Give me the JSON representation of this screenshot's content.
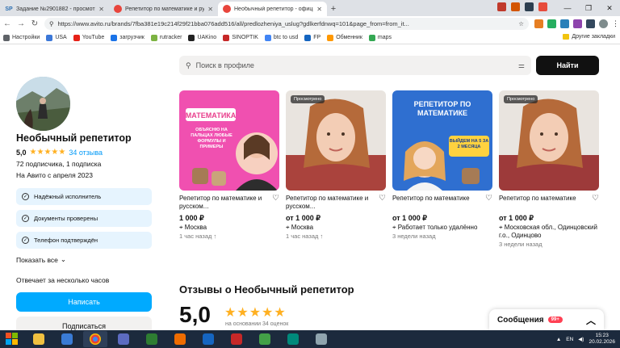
{
  "browser": {
    "tabs": [
      {
        "title": "Задание №2901882 - просмотр з",
        "favicon": "SP",
        "active": false
      },
      {
        "title": "Репетитор по математике и русс",
        "favicon": "avito",
        "active": false
      },
      {
        "title": "Необычный репетитор - официа",
        "favicon": "avito",
        "active": true
      }
    ],
    "new_tab": "+",
    "url": "https://www.avito.ru/brands/7fba381e19c214f29f21bba076add516/all/predlozheniya_uslug?gdlkerfdnwq=101&page_from=from_it...",
    "bookmarks": [
      "Настройки",
      "USA",
      "YouTube",
      "загрузчик",
      "rutracker",
      "UAKino",
      "SINOPTIK",
      "btc to usd",
      "FP",
      "Обменник",
      "maps"
    ],
    "other_bookmarks": "Другие закладки"
  },
  "profile": {
    "name": "Необычный репетитор",
    "rating": "5,0",
    "stars": "★★★★★",
    "reviews_link": "34 отзыва",
    "subscribers": "72 подписчика, 1 подписка",
    "since": "На Авито с апреля 2023",
    "badges": [
      "Надёжный исполнитель",
      "Документы проверены",
      "Телефон подтверждён"
    ],
    "show_all": "Показать все",
    "reply_time": "Отвечает за несколько часов",
    "write_button": "Написать",
    "subscribe_button": "Подписаться"
  },
  "search": {
    "placeholder": "Поиск в профиле",
    "button": "Найти"
  },
  "listings": [
    {
      "title": "Репетитор по математике и русском...",
      "price": "1 000 ₽",
      "location": "Москва",
      "time": "1 час назад",
      "viewed": false,
      "image_text": [
        "МАТЕМАТИКА",
        "ОБЪЯСНЮ НА ПАЛЬЦАХ ЛЮБЫЕ ФОРМУЛЫ И ПРИМЕРЫ"
      ]
    },
    {
      "title": "Репетитор по математике и русском...",
      "price": "от 1 000 ₽",
      "location": "Москва",
      "time": "1 час назад",
      "viewed": true,
      "image_text": []
    },
    {
      "title": "Репетитор по математике",
      "price": "от 1 000 ₽",
      "location": "Работает только удалённо",
      "time": "3 недели назад",
      "viewed": false,
      "image_text": [
        "РЕПЕТИТОР ПО МАТЕМАТИКЕ",
        "ВЫЙДЕМ НА 5 ЗА 2 МЕСЯЦА"
      ]
    },
    {
      "title": "Репетитор по математике",
      "price": "от 1 000 ₽",
      "location": "Московская обл., Одинцовский г.о., Одинцово",
      "time": "3 недели назад",
      "viewed": true,
      "image_text": []
    }
  ],
  "viewed_label": "Просмотрено",
  "reviews": {
    "title": "Отзывы о Необычный репетитор",
    "score": "5,0",
    "stars": "★★★★★",
    "based_on": "на основании 34 оценок"
  },
  "messages": {
    "label": "Сообщения",
    "count": "99+"
  },
  "taskbar": {
    "lang": "EN",
    "time": "15:23",
    "date": "20.02.2026"
  },
  "colors": {
    "accent": "#00aaff",
    "star": "#ffb021",
    "badge_bg": "#e6f4fe",
    "link": "#0099f7"
  }
}
